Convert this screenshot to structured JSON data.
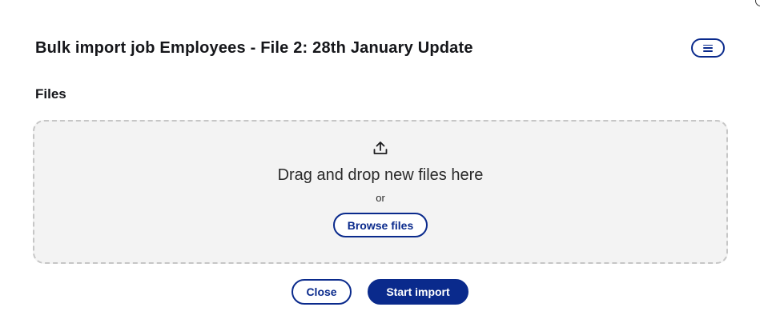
{
  "dialog": {
    "title": "Bulk import job Employees - File 2: 28th January Update",
    "menu_icon": "menu-icon",
    "files_label": "Files",
    "dropzone": {
      "icon": "upload-icon",
      "drop_text": "Drag and drop new files here",
      "or_text": "or",
      "browse_label": "Browse files"
    },
    "footer": {
      "close_label": "Close",
      "start_label": "Start import"
    }
  },
  "colors": {
    "accent": "#0a2a8c",
    "dropzone_bg": "#f3f3f3",
    "dropzone_border": "#c6c6c6",
    "text": "#15161a"
  }
}
